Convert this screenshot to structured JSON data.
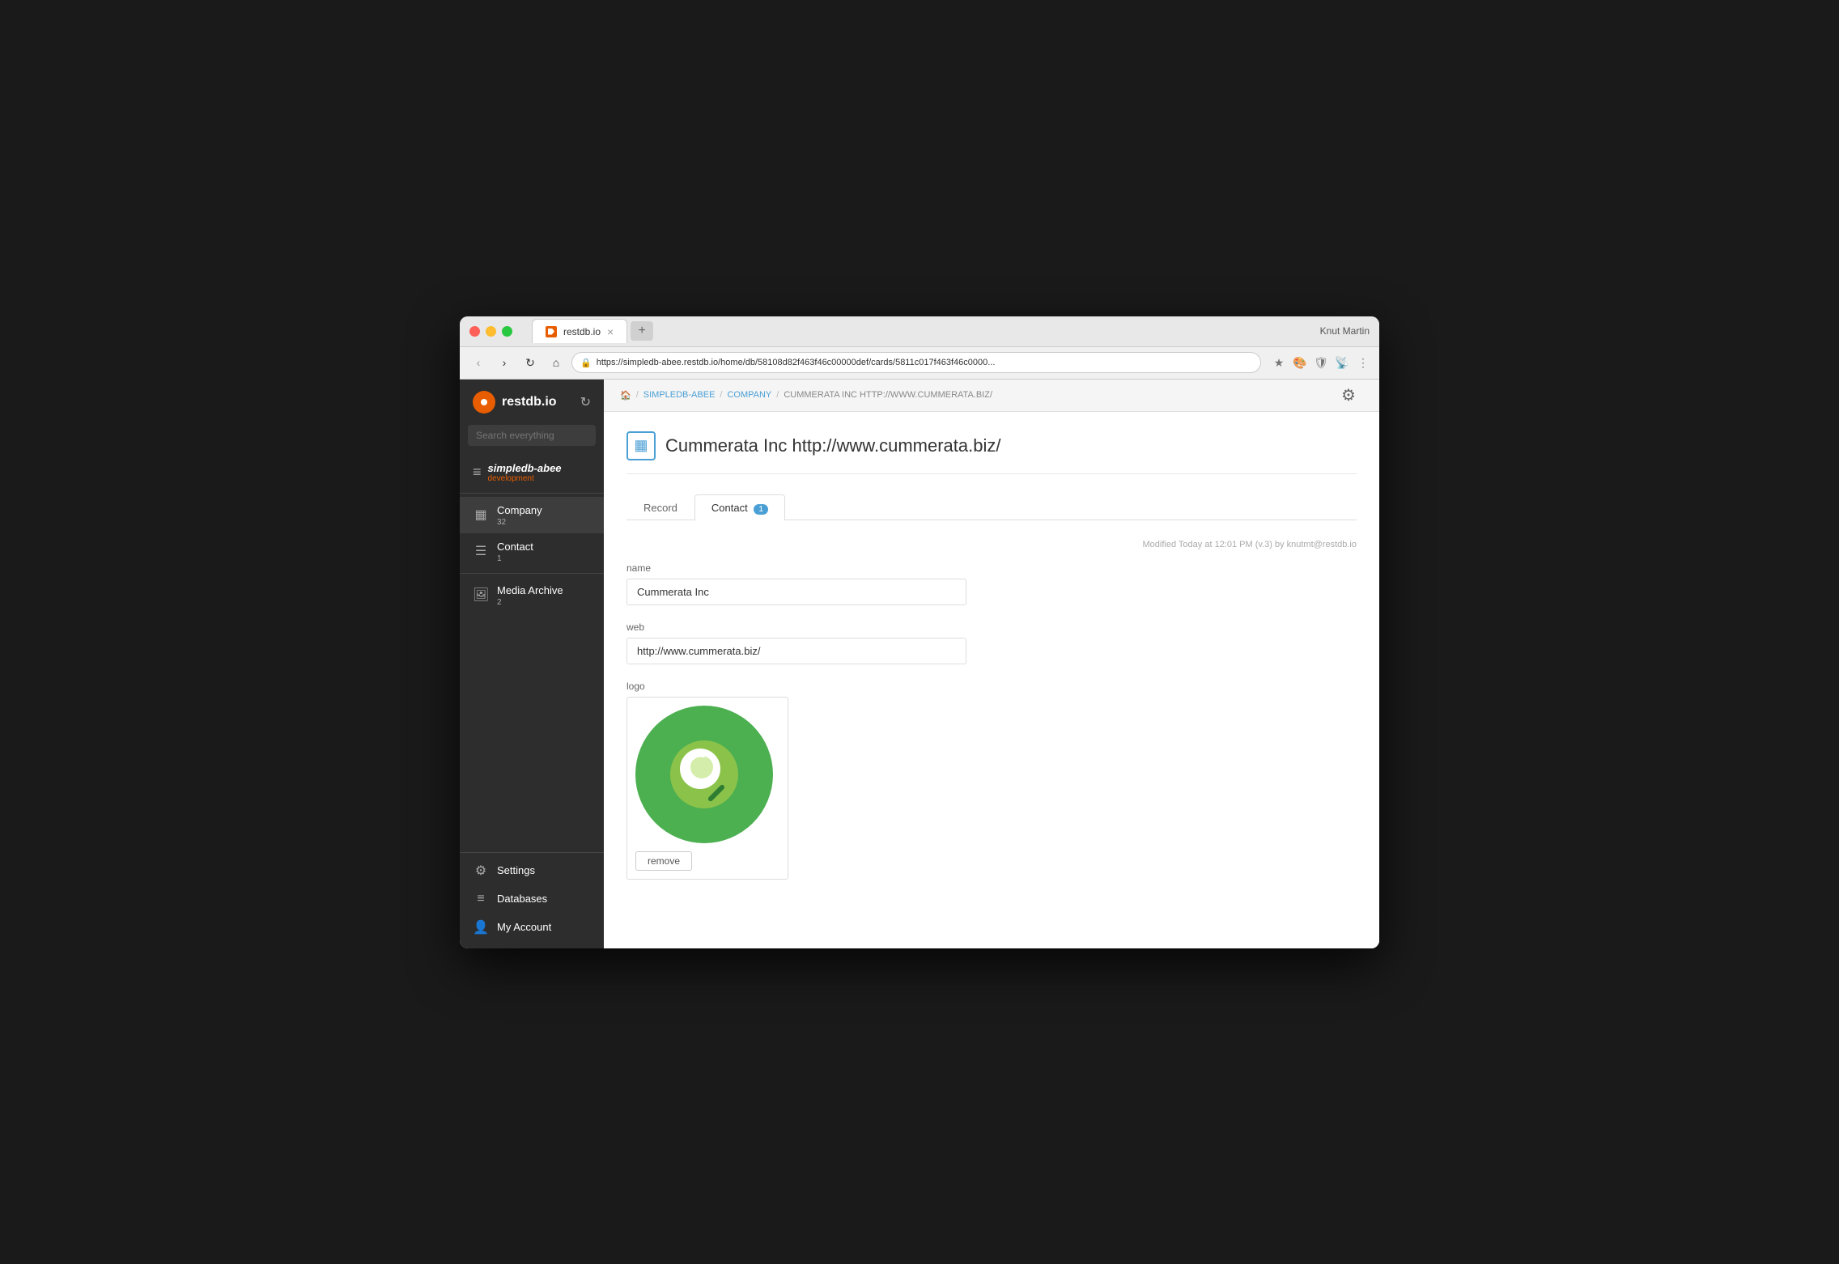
{
  "browser": {
    "tab_favicon": "restdb-favicon",
    "tab_title": "restdb.io",
    "tab_close": "×",
    "new_tab_label": "+",
    "user": "Knut Martin",
    "nav_back": "‹",
    "nav_forward": "›",
    "nav_refresh": "↻",
    "nav_home": "⌂",
    "url": "https://simpledb-abee.restdb.io/home/db/58108d82f463f46c00000def/cards/5811c017f463f46c0000...",
    "nav_icons": [
      "★",
      "🎨",
      "🛡",
      "📡",
      "⋮"
    ]
  },
  "sidebar": {
    "logo_text": "restdb.io",
    "db_name": "simpledb-abee",
    "db_env": "development",
    "search_placeholder": "Search everything",
    "items": [
      {
        "id": "company",
        "label": "Company",
        "count": "32"
      },
      {
        "id": "contact",
        "label": "Contact",
        "count": "1"
      }
    ],
    "media_label": "Media Archive",
    "media_count": "2",
    "settings_label": "Settings",
    "databases_label": "Databases",
    "account_label": "My Account"
  },
  "breadcrumb": {
    "home_icon": "🏠",
    "simpledb": "SIMPLEDB-ABEE",
    "company": "COMPANY",
    "current": "CUMMERATA INC HTTP://WWW.CUMMERATA.BIZ/"
  },
  "page": {
    "icon": "▦",
    "title": "Cummerata Inc http://www.cummerata.biz/"
  },
  "tabs": [
    {
      "id": "record",
      "label": "Record",
      "active": false
    },
    {
      "id": "contact",
      "label": "Contact",
      "active": true,
      "badge": "1"
    }
  ],
  "form": {
    "modified_info": "Modified Today at 12:01 PM (v.3) by knutmt@restdb.io",
    "name_label": "name",
    "name_value": "Cummerata Inc",
    "web_label": "web",
    "web_value": "http://www.cummerata.biz/",
    "logo_label": "logo",
    "remove_btn": "remove"
  }
}
